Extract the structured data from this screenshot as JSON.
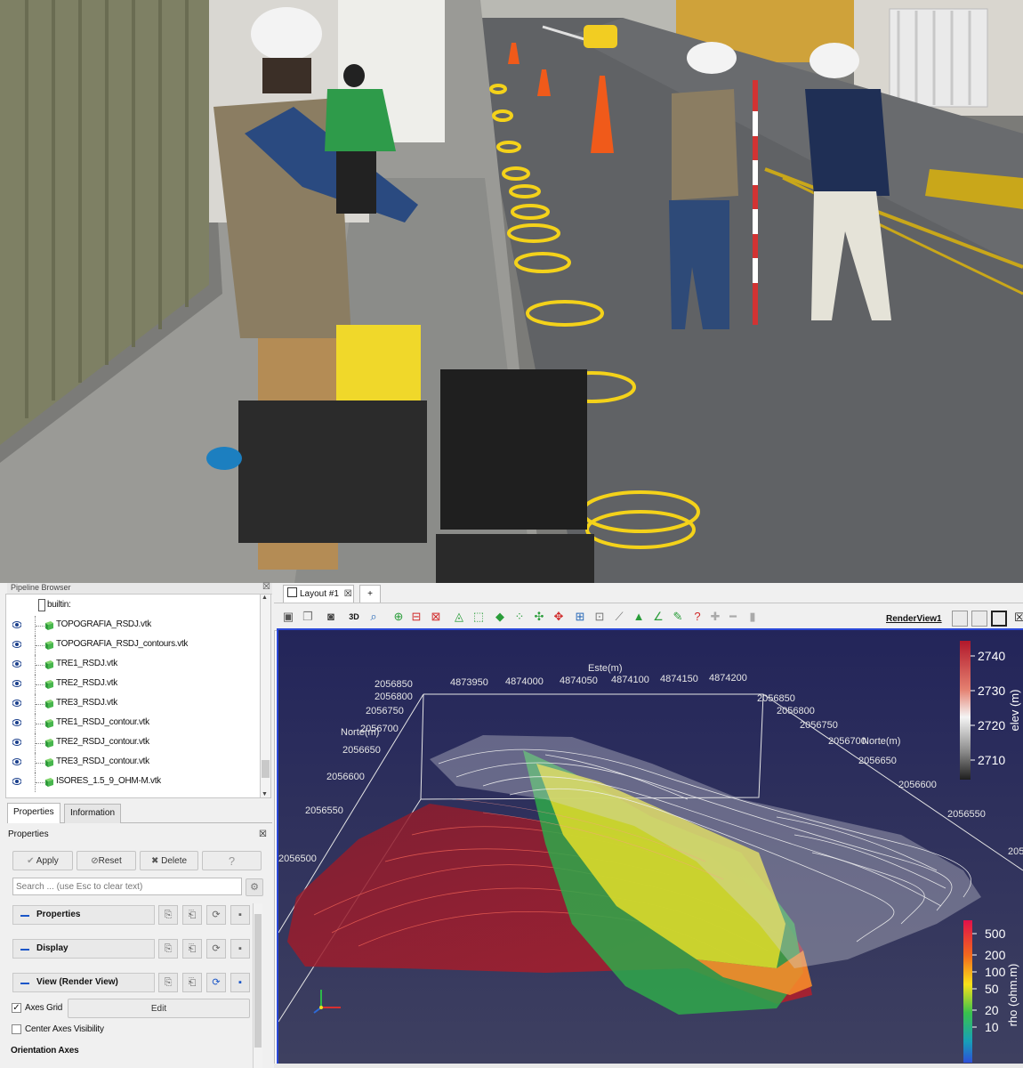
{
  "pipeline_browser": {
    "title": "Pipeline Browser",
    "root": "builtin:",
    "items": [
      {
        "label": "TOPOGRAFIA_RSDJ.vtk"
      },
      {
        "label": "TOPOGRAFIA_RSDJ_contours.vtk"
      },
      {
        "label": "TRE1_RSDJ.vtk"
      },
      {
        "label": "TRE2_RSDJ.vtk"
      },
      {
        "label": "TRE3_RSDJ.vtk"
      },
      {
        "label": "TRE1_RSDJ_contour.vtk"
      },
      {
        "label": "TRE2_RSDJ_contour.vtk"
      },
      {
        "label": "TRE3_RSDJ_contour.vtk"
      },
      {
        "label": "ISORES_1.5_9_OHM-M.vtk"
      }
    ]
  },
  "tabs": {
    "properties": "Properties",
    "information": "Information"
  },
  "properties": {
    "title": "Properties",
    "apply": "Apply",
    "reset": "Reset",
    "delete": "Delete",
    "help": "?",
    "search_placeholder": "Search ... (use Esc to clear text)",
    "sections": {
      "properties": "Properties",
      "display": "Display",
      "view": "View (Render View)"
    },
    "axes_grid": "Axes Grid",
    "axes_grid_checked": true,
    "edit": "Edit",
    "center_axes": "Center Axes Visibility",
    "center_axes_checked": false,
    "orientation_axes": "Orientation Axes"
  },
  "layout": {
    "tab": "Layout #1",
    "add": "+",
    "render_view": "RenderView1",
    "mode_3d": "3D"
  },
  "render": {
    "este_label": "Este(m)",
    "norte_left_label": "Norte(m)",
    "norte_right_label": "Norte(m)",
    "top_x_ticks": [
      "4873950",
      "4874000",
      "4874050",
      "4874100",
      "4874150",
      "4874200"
    ],
    "left_ticks_top": [
      "2056850",
      "2056800",
      "2056750",
      "2056700",
      "2056650"
    ],
    "left_ticks_side": [
      "2056600",
      "2056550",
      "2056500"
    ],
    "right_ticks": [
      "2056850",
      "2056800",
      "2056750",
      "2056700",
      "2056650",
      "2056600",
      "2056550",
      "205"
    ],
    "elev_bar": {
      "title": "elev (m)",
      "ticks": [
        "2740",
        "2730",
        "2720",
        "2710"
      ],
      "colors": [
        "#b2182b",
        "#e06b5a",
        "#f0f0f0",
        "#9b9b9b",
        "#2a2a2a"
      ]
    },
    "rho_bar": {
      "title": "rho (ohm.m)",
      "ticks": [
        "500",
        "200",
        "100",
        "50",
        "20",
        "10"
      ],
      "colors": [
        "#e0114a",
        "#f36a1c",
        "#f8e21a",
        "#39c24c",
        "#17a0b8",
        "#2d4fd8"
      ]
    }
  }
}
